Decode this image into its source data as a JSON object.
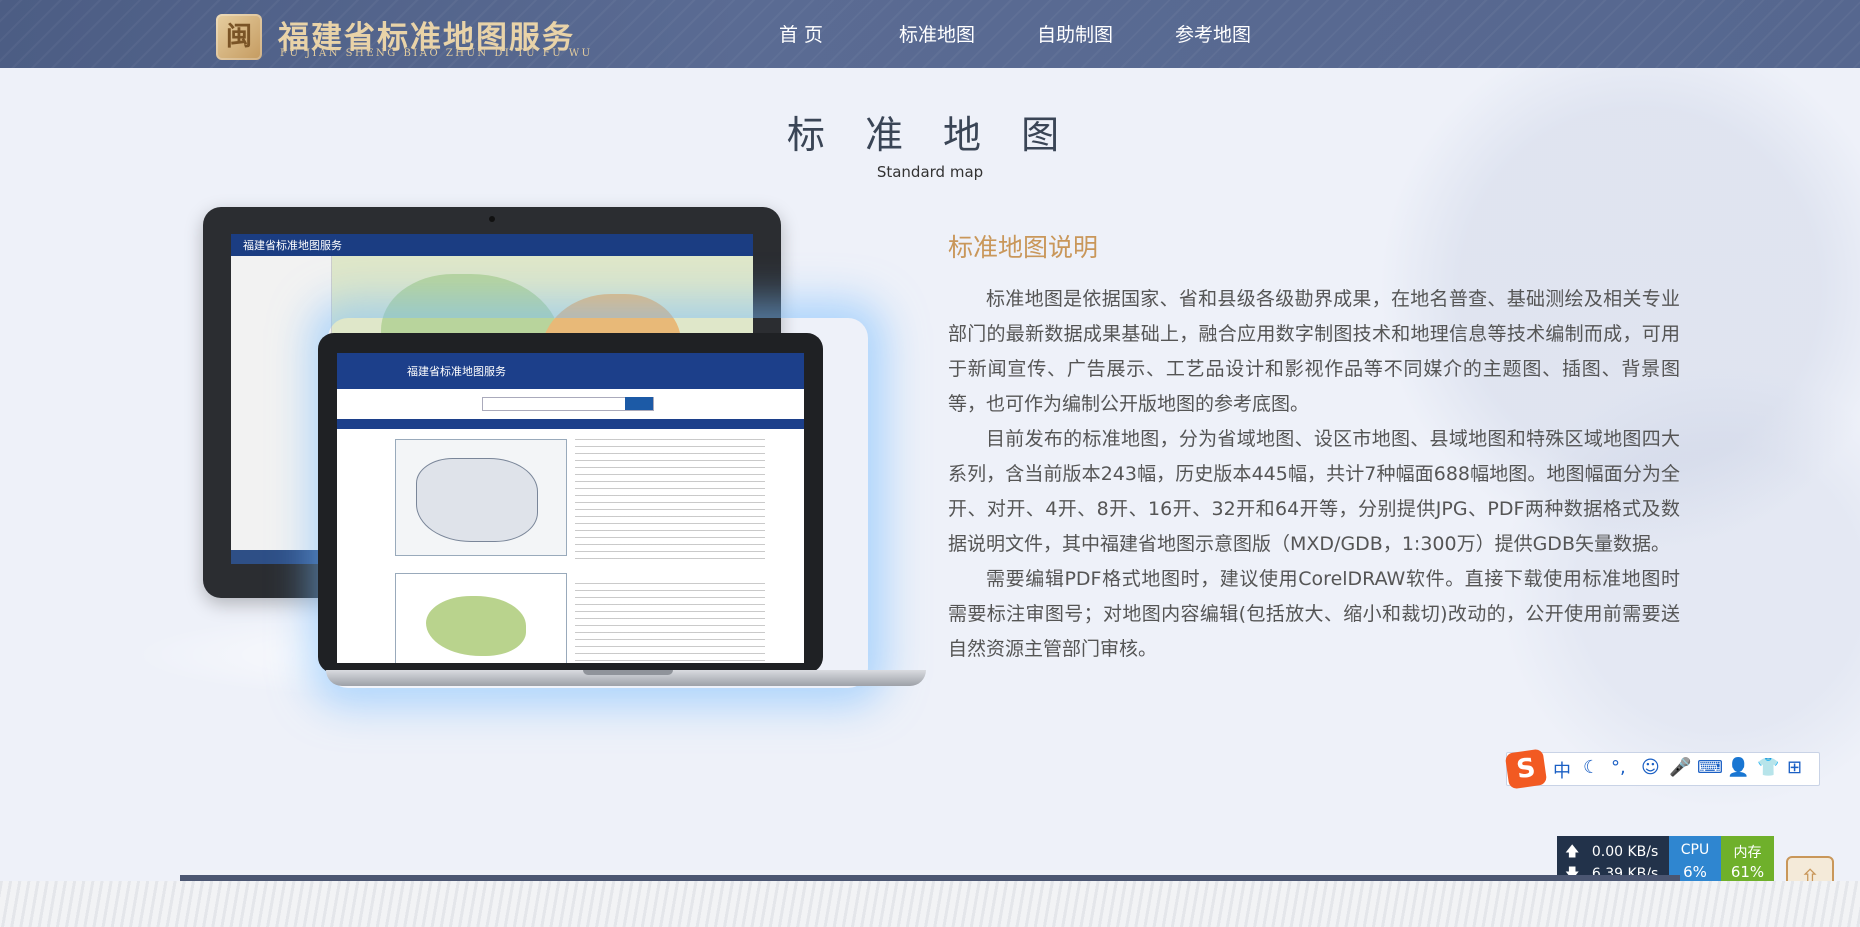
{
  "header": {
    "logo_mark": "闽",
    "logo_cn": "福建省标准地图服务",
    "logo_en": "FU JIAN SHENG BIAO ZHUN DI TU FU WU",
    "nav": [
      {
        "label": "首 页"
      },
      {
        "label": "标准地图"
      },
      {
        "label": "自助制图"
      },
      {
        "label": "参考地图"
      }
    ]
  },
  "main": {
    "title": "标 准 地 图",
    "subtitle": "Standard map",
    "desc_title": "标准地图说明",
    "paragraphs": [
      "标准地图是依据国家、省和县级各级勘界成果，在地名普查、基础测绘及相关专业部门的最新数据成果基础上，融合应用数字制图技术和地理信息等技术编制而成，可用于新闻宣传、广告展示、工艺品设计和影视作品等不同媒介的主题图、插图、背景图等，也可作为编制公开版地图的参考底图。",
      "目前发布的标准地图，分为省域地图、设区市地图、县域地图和特殊区域地图四大系列，含当前版本243幅，历史版本445幅，共计7种幅面688幅地图。地图幅面分为全开、对开、4开、8开、16开、32开和64开等，分别提供JPG、PDF两种数据格式及数据说明文件，其中福建省地图示意图版（MXD/GDB，1:300万）提供GDB矢量数据。",
      "需要编辑PDF格式地图时，建议使用CorelDRAW软件。直接下载使用标准地图时需要标注审图号；对地图内容编辑(包括放大、缩小和裁切)改动的，公开使用前需要送自然资源主管部门审核。"
    ],
    "monitor_title": "福建省标准地图服务",
    "laptop_title": "福建省标准地图服务"
  },
  "ime": {
    "logo": "S",
    "items": [
      {
        "icon": "chinese-mode-icon",
        "glyph": "中"
      },
      {
        "icon": "moon-icon",
        "glyph": "☾"
      },
      {
        "icon": "punctuation-icon",
        "glyph": "°,"
      },
      {
        "icon": "emoji-icon",
        "glyph": "☺"
      },
      {
        "icon": "microphone-icon",
        "glyph": "🎤"
      },
      {
        "icon": "keyboard-icon",
        "glyph": "⌨"
      },
      {
        "icon": "user-icon",
        "glyph": "👤"
      },
      {
        "icon": "skin-icon",
        "glyph": "👕"
      },
      {
        "icon": "grid-icon",
        "glyph": "⊞"
      }
    ]
  },
  "netmon": {
    "up": "0.00 KB/s",
    "down": "6.39 KB/s",
    "up_arrow": "🡅",
    "down_arrow": "🡇",
    "cpu_label": "CPU",
    "cpu_value": "6%",
    "mem_label": "内存",
    "mem_value": "61%",
    "colors": {
      "speed": "#22324a",
      "cpu": "#2f86d0",
      "mem": "#6fb02b"
    }
  },
  "back_top": {
    "icon": "arrow-up-icon",
    "glyph": "⇧"
  },
  "colors": {
    "header": "#4c5d84",
    "accent": "#c9975a",
    "background": "#eef1f9"
  }
}
